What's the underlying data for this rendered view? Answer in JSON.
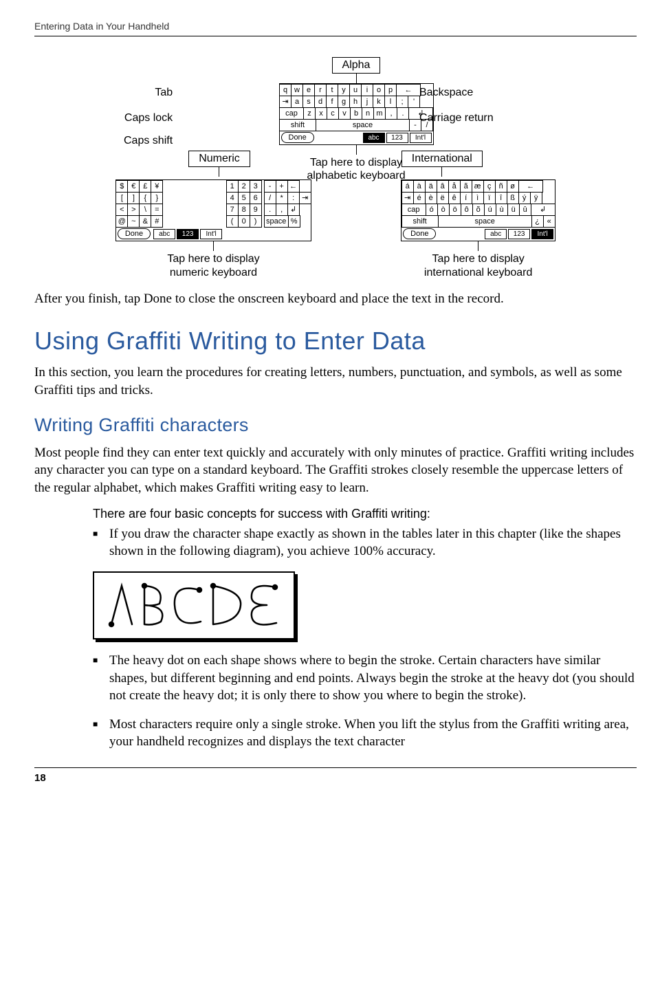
{
  "header": {
    "running": "Entering Data in Your Handheld"
  },
  "pageNumber": "18",
  "diagram": {
    "tags": {
      "alpha": "Alpha",
      "numeric": "Numeric",
      "international": "International"
    },
    "labelsLeft": {
      "tab": "Tab",
      "capsLock": "Caps lock",
      "capsShift": "Caps shift"
    },
    "labelsRight": {
      "backspace": "Backspace",
      "carriage": "Carriage return"
    },
    "captions": {
      "alpha": "Tap here to display\nalphabetic keyboard",
      "numeric": "Tap here to display\nnumeric keyboard",
      "international": "Tap here to display\ninternational keyboard"
    },
    "mode": {
      "done": "Done",
      "abc": "abc",
      "n123": "123",
      "intl": "Int'l"
    },
    "alphaRows": [
      [
        "q",
        "w",
        "e",
        "r",
        "t",
        "y",
        "u",
        "i",
        "o",
        "p",
        "←"
      ],
      [
        "⇥",
        "a",
        "s",
        "d",
        "f",
        "g",
        "h",
        "j",
        "k",
        "l",
        ";",
        "'"
      ],
      [
        "cap",
        "z",
        "x",
        "c",
        "v",
        "b",
        "n",
        "m",
        ",",
        ".",
        "↲"
      ],
      [
        "shift",
        "space",
        "-",
        "/"
      ]
    ],
    "numLeft": [
      [
        "$",
        "€",
        "£",
        "¥"
      ],
      [
        "[",
        "]",
        "{",
        "}"
      ],
      [
        "<",
        ">",
        "\\",
        "="
      ],
      [
        "@",
        "~",
        "&",
        "#"
      ]
    ],
    "numMid": [
      [
        "1",
        "2",
        "3"
      ],
      [
        "4",
        "5",
        "6"
      ],
      [
        "7",
        "8",
        "9"
      ],
      [
        "(",
        "0",
        ")"
      ]
    ],
    "numRight": [
      [
        "-",
        "+",
        "←"
      ],
      [
        "/",
        "*",
        ":",
        "⇥"
      ],
      [
        ".",
        ",",
        "↲"
      ],
      [
        "space",
        "%"
      ]
    ],
    "intlRows": [
      [
        "á",
        "à",
        "ä",
        "â",
        "å",
        "ã",
        "æ",
        "ç",
        "ñ",
        "ø",
        "←"
      ],
      [
        "⇥",
        "é",
        "è",
        "ë",
        "ê",
        "í",
        "ì",
        "ï",
        "î",
        "ß",
        "ý",
        "ÿ"
      ],
      [
        "cap",
        "ó",
        "ò",
        "ö",
        "ô",
        "õ",
        "ú",
        "ù",
        "ü",
        "û",
        "↲"
      ],
      [
        "shift",
        "space",
        "¿",
        "«"
      ]
    ]
  },
  "p_afterFinish": "After you finish, tap Done to close the onscreen keyboard and place the text in the record.",
  "h_graffiti": "Using Graffiti Writing to Enter Data",
  "p_graffitiIntro": "In this section, you learn the procedures for creating letters, numbers, punctuation, and symbols, as well as some Graffiti tips and tricks.",
  "h_writing": "Writing Graffiti characters",
  "p_writing": "Most people find they can enter text quickly and accurately with only minutes of practice. Graffiti writing includes any character you can type on a standard keyboard. The Graffiti strokes closely resemble the uppercase letters of the regular alphabet, which makes Graffiti writing easy to learn.",
  "runin": "There are four basic concepts for success with Graffiti writing:",
  "bullets": [
    "If you draw the character shape exactly as shown in the tables later in this chapter (like the shapes shown in the following diagram), you achieve 100% accuracy.",
    "The heavy dot on each shape shows where to begin the stroke. Certain characters have similar shapes, but different beginning and end points. Always begin the stroke at the heavy dot (you should not create the heavy dot; it is only there to show you where to begin the stroke).",
    "Most characters require only a single stroke. When you lift the stylus from the Graffiti writing area, your handheld recognizes and displays the text character"
  ]
}
